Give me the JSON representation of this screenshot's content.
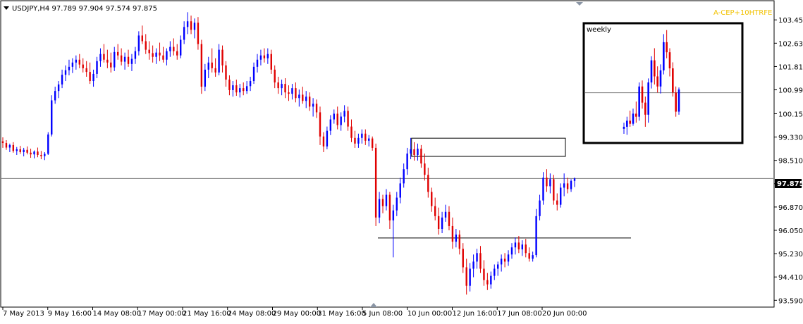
{
  "header": {
    "symbol_line": "USDJPY,H4  97.789 97.904 97.574 97.875",
    "ea_label": "A-CEP+10HTRFE",
    "menu_icon": "triangle-down-icon",
    "scroll_marker_icon": "triangle-down-icon",
    "bottom_marker_icon": "triangle-up-icon"
  },
  "colors": {
    "bull": "#0000ff",
    "bear": "#e00000",
    "current_price_bg": "#000000",
    "ea_label": "#f2c200",
    "axis": "#000000",
    "grid_line": "#808080"
  },
  "current_price": {
    "value": 97.875,
    "label": "97.875"
  },
  "inset": {
    "title": "weekly"
  },
  "chart_data": {
    "type": "candlestick",
    "y_ticks": [
      "103.450",
      "102.630",
      "101.810",
      "100.990",
      "100.150",
      "99.330",
      "98.510",
      "97.690",
      "96.870",
      "96.050",
      "95.230",
      "94.410",
      "93.590"
    ],
    "y_tick_values": [
      103.45,
      102.63,
      101.81,
      100.99,
      100.15,
      99.33,
      98.51,
      97.69,
      96.87,
      96.05,
      95.23,
      94.41,
      93.59
    ],
    "ylim": [
      93.4,
      104.05
    ],
    "x_ticks": [
      "7 May 2013",
      "9 May 16:00",
      "14 May 08:00",
      "17 May 00:00",
      "21 May 16:00",
      "24 May 08:00",
      "29 May 00:00",
      "31 May 16:00",
      "5 Jun 08:00",
      "10 Jun 00:00",
      "12 Jun 16:00",
      "17 Jun 08:00",
      "20 Jun 00:00"
    ],
    "annotations": [
      {
        "type": "rectangle",
        "price_top": 99.29,
        "price_bottom": 98.65,
        "from_x_label": "10 Jun 00:00",
        "to_x_label": "20 Jun 00:00"
      },
      {
        "type": "horizontal-segment",
        "price": 95.78,
        "from_x_label": "5 Jun 08:00",
        "to_x_label": "20 Jun 00:00"
      }
    ],
    "key_prices": {
      "first_close": 99.12,
      "high": 103.72,
      "high_date": "22 May 2013",
      "low": 93.79,
      "low_date": "13 Jun 2013",
      "last_close": 97.875
    },
    "ohlc": [
      {
        "o": 99.18,
        "h": 99.32,
        "l": 98.95,
        "c": 99.12
      },
      {
        "o": 99.12,
        "h": 99.22,
        "l": 98.88,
        "c": 98.96
      },
      {
        "o": 98.96,
        "h": 99.1,
        "l": 98.8,
        "c": 99.05
      },
      {
        "o": 99.05,
        "h": 99.15,
        "l": 98.78,
        "c": 98.84
      },
      {
        "o": 98.84,
        "h": 98.98,
        "l": 98.7,
        "c": 98.9
      },
      {
        "o": 98.9,
        "h": 99.02,
        "l": 98.74,
        "c": 98.8
      },
      {
        "o": 98.8,
        "h": 98.95,
        "l": 98.65,
        "c": 98.88
      },
      {
        "o": 98.88,
        "h": 99.0,
        "l": 98.72,
        "c": 98.78
      },
      {
        "o": 98.78,
        "h": 98.92,
        "l": 98.6,
        "c": 98.72
      },
      {
        "o": 98.72,
        "h": 98.86,
        "l": 98.58,
        "c": 98.82
      },
      {
        "o": 98.82,
        "h": 98.96,
        "l": 98.62,
        "c": 98.7
      },
      {
        "o": 98.7,
        "h": 98.84,
        "l": 98.55,
        "c": 98.66
      },
      {
        "o": 98.66,
        "h": 98.8,
        "l": 98.52,
        "c": 98.74
      },
      {
        "o": 98.74,
        "h": 99.5,
        "l": 98.7,
        "c": 99.42
      },
      {
        "o": 99.42,
        "h": 100.8,
        "l": 99.35,
        "c": 100.62
      },
      {
        "o": 100.62,
        "h": 101.1,
        "l": 100.5,
        "c": 100.95
      },
      {
        "o": 100.95,
        "h": 101.3,
        "l": 100.7,
        "c": 101.18
      },
      {
        "o": 101.18,
        "h": 101.7,
        "l": 101.05,
        "c": 101.52
      },
      {
        "o": 101.52,
        "h": 101.85,
        "l": 101.3,
        "c": 101.68
      },
      {
        "o": 101.68,
        "h": 102.05,
        "l": 101.5,
        "c": 101.8
      },
      {
        "o": 101.8,
        "h": 102.1,
        "l": 101.58,
        "c": 101.95
      },
      {
        "o": 101.95,
        "h": 102.2,
        "l": 101.7,
        "c": 102.05
      },
      {
        "o": 102.05,
        "h": 102.25,
        "l": 101.75,
        "c": 101.88
      },
      {
        "o": 101.88,
        "h": 102.1,
        "l": 101.6,
        "c": 101.75
      },
      {
        "o": 101.75,
        "h": 102.0,
        "l": 101.45,
        "c": 101.62
      },
      {
        "o": 101.62,
        "h": 101.95,
        "l": 101.2,
        "c": 101.3
      },
      {
        "o": 101.3,
        "h": 101.7,
        "l": 101.1,
        "c": 101.55
      },
      {
        "o": 101.55,
        "h": 102.15,
        "l": 101.4,
        "c": 102.0
      },
      {
        "o": 102.0,
        "h": 102.45,
        "l": 101.8,
        "c": 102.25
      },
      {
        "o": 102.25,
        "h": 102.6,
        "l": 101.95,
        "c": 102.05
      },
      {
        "o": 102.05,
        "h": 102.4,
        "l": 101.75,
        "c": 101.95
      },
      {
        "o": 101.95,
        "h": 102.3,
        "l": 101.6,
        "c": 101.78
      },
      {
        "o": 101.78,
        "h": 102.5,
        "l": 101.65,
        "c": 102.32
      },
      {
        "o": 102.32,
        "h": 102.6,
        "l": 102.05,
        "c": 102.2
      },
      {
        "o": 102.2,
        "h": 102.45,
        "l": 101.85,
        "c": 101.98
      },
      {
        "o": 101.98,
        "h": 102.3,
        "l": 101.7,
        "c": 102.15
      },
      {
        "o": 102.15,
        "h": 102.4,
        "l": 101.8,
        "c": 101.9
      },
      {
        "o": 101.9,
        "h": 102.25,
        "l": 101.65,
        "c": 102.08
      },
      {
        "o": 102.08,
        "h": 102.5,
        "l": 101.9,
        "c": 102.35
      },
      {
        "o": 102.35,
        "h": 103.05,
        "l": 102.2,
        "c": 102.9
      },
      {
        "o": 102.9,
        "h": 103.25,
        "l": 102.6,
        "c": 102.7
      },
      {
        "o": 102.7,
        "h": 102.95,
        "l": 102.25,
        "c": 102.4
      },
      {
        "o": 102.4,
        "h": 102.7,
        "l": 102.05,
        "c": 102.28
      },
      {
        "o": 102.28,
        "h": 102.55,
        "l": 101.95,
        "c": 102.15
      },
      {
        "o": 102.15,
        "h": 102.45,
        "l": 101.9,
        "c": 102.3
      },
      {
        "o": 102.3,
        "h": 102.65,
        "l": 102.0,
        "c": 102.2
      },
      {
        "o": 102.2,
        "h": 102.5,
        "l": 101.95,
        "c": 102.05
      },
      {
        "o": 102.05,
        "h": 102.45,
        "l": 101.85,
        "c": 102.35
      },
      {
        "o": 102.35,
        "h": 102.7,
        "l": 102.15,
        "c": 102.5
      },
      {
        "o": 102.5,
        "h": 102.8,
        "l": 102.2,
        "c": 102.35
      },
      {
        "o": 102.35,
        "h": 102.6,
        "l": 102.05,
        "c": 102.2
      },
      {
        "o": 102.2,
        "h": 102.9,
        "l": 102.1,
        "c": 102.75
      },
      {
        "o": 102.75,
        "h": 103.4,
        "l": 102.6,
        "c": 103.2
      },
      {
        "o": 103.2,
        "h": 103.72,
        "l": 102.95,
        "c": 103.4
      },
      {
        "o": 103.4,
        "h": 103.6,
        "l": 102.95,
        "c": 103.1
      },
      {
        "o": 103.1,
        "h": 103.5,
        "l": 102.8,
        "c": 103.35
      },
      {
        "o": 103.35,
        "h": 103.55,
        "l": 102.4,
        "c": 102.6
      },
      {
        "o": 102.6,
        "h": 102.75,
        "l": 100.85,
        "c": 101.1
      },
      {
        "o": 101.1,
        "h": 101.9,
        "l": 100.95,
        "c": 101.7
      },
      {
        "o": 101.7,
        "h": 102.15,
        "l": 101.4,
        "c": 101.95
      },
      {
        "o": 101.95,
        "h": 102.45,
        "l": 101.6,
        "c": 101.75
      },
      {
        "o": 101.75,
        "h": 102.1,
        "l": 101.45,
        "c": 101.6
      },
      {
        "o": 101.6,
        "h": 102.6,
        "l": 101.5,
        "c": 102.4
      },
      {
        "o": 102.4,
        "h": 102.55,
        "l": 101.6,
        "c": 101.85
      },
      {
        "o": 101.85,
        "h": 102.0,
        "l": 101.1,
        "c": 101.35
      },
      {
        "o": 101.35,
        "h": 101.5,
        "l": 100.8,
        "c": 100.98
      },
      {
        "o": 100.98,
        "h": 101.3,
        "l": 100.75,
        "c": 101.15
      },
      {
        "o": 101.15,
        "h": 101.35,
        "l": 100.78,
        "c": 100.9
      },
      {
        "o": 100.9,
        "h": 101.2,
        "l": 100.72,
        "c": 101.05
      },
      {
        "o": 101.05,
        "h": 101.25,
        "l": 100.8,
        "c": 100.95
      },
      {
        "o": 100.95,
        "h": 101.3,
        "l": 100.85,
        "c": 101.12
      },
      {
        "o": 101.12,
        "h": 101.45,
        "l": 100.95,
        "c": 101.3
      },
      {
        "o": 101.3,
        "h": 101.95,
        "l": 101.2,
        "c": 101.8
      },
      {
        "o": 101.8,
        "h": 102.25,
        "l": 101.6,
        "c": 102.05
      },
      {
        "o": 102.05,
        "h": 102.4,
        "l": 101.85,
        "c": 102.2
      },
      {
        "o": 102.2,
        "h": 102.45,
        "l": 101.95,
        "c": 102.1
      },
      {
        "o": 102.1,
        "h": 102.45,
        "l": 101.9,
        "c": 102.25
      },
      {
        "o": 102.25,
        "h": 102.4,
        "l": 101.55,
        "c": 101.7
      },
      {
        "o": 101.7,
        "h": 101.85,
        "l": 101.05,
        "c": 101.25
      },
      {
        "o": 101.25,
        "h": 101.45,
        "l": 100.85,
        "c": 101.05
      },
      {
        "o": 101.05,
        "h": 101.35,
        "l": 100.8,
        "c": 101.2
      },
      {
        "o": 101.2,
        "h": 101.4,
        "l": 100.7,
        "c": 100.9
      },
      {
        "o": 100.9,
        "h": 101.15,
        "l": 100.6,
        "c": 100.85
      },
      {
        "o": 100.85,
        "h": 101.2,
        "l": 100.65,
        "c": 101.05
      },
      {
        "o": 101.05,
        "h": 101.25,
        "l": 100.55,
        "c": 100.7
      },
      {
        "o": 100.7,
        "h": 101.0,
        "l": 100.4,
        "c": 100.82
      },
      {
        "o": 100.82,
        "h": 101.1,
        "l": 100.5,
        "c": 100.6
      },
      {
        "o": 100.6,
        "h": 100.95,
        "l": 100.35,
        "c": 100.75
      },
      {
        "o": 100.75,
        "h": 100.9,
        "l": 100.25,
        "c": 100.4
      },
      {
        "o": 100.4,
        "h": 100.7,
        "l": 100.05,
        "c": 100.5
      },
      {
        "o": 100.5,
        "h": 100.65,
        "l": 100.0,
        "c": 100.2
      },
      {
        "o": 100.2,
        "h": 100.4,
        "l": 99.05,
        "c": 99.35
      },
      {
        "o": 99.35,
        "h": 99.5,
        "l": 98.8,
        "c": 99.0
      },
      {
        "o": 99.0,
        "h": 99.7,
        "l": 98.9,
        "c": 99.55
      },
      {
        "o": 99.55,
        "h": 100.1,
        "l": 99.4,
        "c": 99.95
      },
      {
        "o": 99.95,
        "h": 100.3,
        "l": 99.8,
        "c": 100.15
      },
      {
        "o": 100.15,
        "h": 100.4,
        "l": 99.6,
        "c": 99.75
      },
      {
        "o": 99.75,
        "h": 100.2,
        "l": 99.55,
        "c": 100.05
      },
      {
        "o": 100.05,
        "h": 100.45,
        "l": 99.85,
        "c": 100.25
      },
      {
        "o": 100.25,
        "h": 100.4,
        "l": 99.55,
        "c": 99.7
      },
      {
        "o": 99.7,
        "h": 99.95,
        "l": 99.15,
        "c": 99.3
      },
      {
        "o": 99.3,
        "h": 99.55,
        "l": 98.95,
        "c": 99.1
      },
      {
        "o": 99.1,
        "h": 99.45,
        "l": 98.95,
        "c": 99.3
      },
      {
        "o": 99.3,
        "h": 99.6,
        "l": 99.1,
        "c": 99.45
      },
      {
        "o": 99.45,
        "h": 99.6,
        "l": 99.05,
        "c": 99.2
      },
      {
        "o": 99.2,
        "h": 99.4,
        "l": 99.0,
        "c": 99.28
      },
      {
        "o": 99.28,
        "h": 99.35,
        "l": 98.85,
        "c": 98.95
      },
      {
        "o": 98.95,
        "h": 99.1,
        "l": 96.2,
        "c": 96.5
      },
      {
        "o": 96.5,
        "h": 97.4,
        "l": 96.3,
        "c": 97.15
      },
      {
        "o": 97.15,
        "h": 97.3,
        "l": 96.65,
        "c": 96.9
      },
      {
        "o": 96.9,
        "h": 97.5,
        "l": 96.75,
        "c": 97.3
      },
      {
        "o": 97.3,
        "h": 97.4,
        "l": 96.1,
        "c": 96.4
      },
      {
        "o": 96.4,
        "h": 96.95,
        "l": 95.1,
        "c": 96.75
      },
      {
        "o": 96.75,
        "h": 97.4,
        "l": 96.55,
        "c": 97.2
      },
      {
        "o": 97.2,
        "h": 97.9,
        "l": 97.0,
        "c": 97.7
      },
      {
        "o": 97.7,
        "h": 98.4,
        "l": 97.55,
        "c": 98.2
      },
      {
        "o": 98.2,
        "h": 98.95,
        "l": 98.0,
        "c": 98.75
      },
      {
        "o": 98.75,
        "h": 99.3,
        "l": 98.55,
        "c": 98.9
      },
      {
        "o": 98.9,
        "h": 99.15,
        "l": 98.5,
        "c": 98.7
      },
      {
        "o": 98.7,
        "h": 99.1,
        "l": 98.5,
        "c": 98.92
      },
      {
        "o": 98.92,
        "h": 99.05,
        "l": 98.25,
        "c": 98.4
      },
      {
        "o": 98.4,
        "h": 98.75,
        "l": 97.8,
        "c": 98.0
      },
      {
        "o": 98.0,
        "h": 98.25,
        "l": 97.2,
        "c": 97.4
      },
      {
        "o": 97.4,
        "h": 97.55,
        "l": 96.7,
        "c": 96.9
      },
      {
        "o": 96.9,
        "h": 97.2,
        "l": 96.4,
        "c": 96.55
      },
      {
        "o": 96.55,
        "h": 96.85,
        "l": 95.9,
        "c": 96.1
      },
      {
        "o": 96.1,
        "h": 96.7,
        "l": 95.95,
        "c": 96.5
      },
      {
        "o": 96.5,
        "h": 96.95,
        "l": 96.35,
        "c": 96.7
      },
      {
        "o": 96.7,
        "h": 96.9,
        "l": 96.05,
        "c": 96.2
      },
      {
        "o": 96.2,
        "h": 96.5,
        "l": 95.4,
        "c": 95.65
      },
      {
        "o": 95.65,
        "h": 96.1,
        "l": 95.45,
        "c": 95.9
      },
      {
        "o": 95.9,
        "h": 96.05,
        "l": 95.2,
        "c": 95.4
      },
      {
        "o": 95.4,
        "h": 95.6,
        "l": 94.55,
        "c": 94.75
      },
      {
        "o": 94.75,
        "h": 95.05,
        "l": 93.79,
        "c": 94.1
      },
      {
        "o": 94.1,
        "h": 94.9,
        "l": 93.9,
        "c": 94.7
      },
      {
        "o": 94.7,
        "h": 95.2,
        "l": 94.4,
        "c": 94.95
      },
      {
        "o": 94.95,
        "h": 95.4,
        "l": 94.7,
        "c": 95.25
      },
      {
        "o": 95.25,
        "h": 95.5,
        "l": 94.55,
        "c": 94.7
      },
      {
        "o": 94.7,
        "h": 95.0,
        "l": 94.1,
        "c": 94.3
      },
      {
        "o": 94.3,
        "h": 94.55,
        "l": 93.95,
        "c": 94.15
      },
      {
        "o": 94.15,
        "h": 94.6,
        "l": 94.0,
        "c": 94.45
      },
      {
        "o": 94.45,
        "h": 94.85,
        "l": 94.3,
        "c": 94.7
      },
      {
        "o": 94.7,
        "h": 94.95,
        "l": 94.45,
        "c": 94.85
      },
      {
        "o": 94.85,
        "h": 95.2,
        "l": 94.6,
        "c": 95.05
      },
      {
        "o": 95.05,
        "h": 95.25,
        "l": 94.75,
        "c": 94.95
      },
      {
        "o": 94.95,
        "h": 95.35,
        "l": 94.8,
        "c": 95.2
      },
      {
        "o": 95.2,
        "h": 95.6,
        "l": 95.05,
        "c": 95.45
      },
      {
        "o": 95.45,
        "h": 95.8,
        "l": 95.2,
        "c": 95.62
      },
      {
        "o": 95.62,
        "h": 95.85,
        "l": 95.25,
        "c": 95.38
      },
      {
        "o": 95.38,
        "h": 95.7,
        "l": 95.15,
        "c": 95.55
      },
      {
        "o": 95.55,
        "h": 95.75,
        "l": 95.1,
        "c": 95.25
      },
      {
        "o": 95.25,
        "h": 95.45,
        "l": 94.95,
        "c": 95.05
      },
      {
        "o": 95.05,
        "h": 95.3,
        "l": 94.95,
        "c": 95.18
      },
      {
        "o": 95.18,
        "h": 96.8,
        "l": 95.1,
        "c": 96.55
      },
      {
        "o": 96.55,
        "h": 97.3,
        "l": 96.4,
        "c": 97.1
      },
      {
        "o": 97.1,
        "h": 98.1,
        "l": 96.95,
        "c": 97.9
      },
      {
        "o": 97.9,
        "h": 98.2,
        "l": 97.4,
        "c": 97.6
      },
      {
        "o": 97.6,
        "h": 98.05,
        "l": 97.35,
        "c": 97.85
      },
      {
        "o": 97.85,
        "h": 98.0,
        "l": 96.95,
        "c": 97.1
      },
      {
        "o": 97.1,
        "h": 97.35,
        "l": 96.75,
        "c": 96.95
      },
      {
        "o": 96.95,
        "h": 97.7,
        "l": 96.85,
        "c": 97.55
      },
      {
        "o": 97.55,
        "h": 98.05,
        "l": 97.25,
        "c": 97.7
      },
      {
        "o": 97.7,
        "h": 97.9,
        "l": 97.35,
        "c": 97.5
      },
      {
        "o": 97.5,
        "h": 97.85,
        "l": 97.4,
        "c": 97.79
      },
      {
        "o": 97.789,
        "h": 97.904,
        "l": 97.574,
        "c": 97.875
      }
    ],
    "weekly": {
      "ohlc": [
        {
          "o": 99.2,
          "h": 99.5,
          "l": 98.95,
          "c": 99.3
        },
        {
          "o": 99.3,
          "h": 99.8,
          "l": 98.9,
          "c": 99.6
        },
        {
          "o": 99.6,
          "h": 100.1,
          "l": 99.3,
          "c": 99.45
        },
        {
          "o": 99.45,
          "h": 100.2,
          "l": 99.35,
          "c": 99.95
        },
        {
          "o": 99.95,
          "h": 100.55,
          "l": 99.5,
          "c": 99.8
        },
        {
          "o": 99.8,
          "h": 101.5,
          "l": 99.6,
          "c": 101.3
        },
        {
          "o": 101.3,
          "h": 101.6,
          "l": 100.2,
          "c": 100.5
        },
        {
          "o": 100.5,
          "h": 100.8,
          "l": 99.3,
          "c": 99.9
        },
        {
          "o": 99.9,
          "h": 101.7,
          "l": 99.5,
          "c": 101.5
        },
        {
          "o": 101.5,
          "h": 102.8,
          "l": 101.2,
          "c": 102.6
        },
        {
          "o": 102.6,
          "h": 103.2,
          "l": 101.4,
          "c": 101.8
        },
        {
          "o": 101.8,
          "h": 102.3,
          "l": 101.0,
          "c": 101.3
        },
        {
          "o": 101.3,
          "h": 102.4,
          "l": 100.95,
          "c": 102.1
        },
        {
          "o": 102.1,
          "h": 103.9,
          "l": 101.9,
          "c": 103.5
        },
        {
          "o": 103.5,
          "h": 104.1,
          "l": 102.7,
          "c": 103.0
        },
        {
          "o": 103.0,
          "h": 103.2,
          "l": 101.8,
          "c": 102.2
        },
        {
          "o": 102.2,
          "h": 102.5,
          "l": 100.8,
          "c": 101.0
        },
        {
          "o": 101.0,
          "h": 101.3,
          "l": 99.8,
          "c": 100.05
        },
        {
          "o": 100.05,
          "h": 101.25,
          "l": 99.9,
          "c": 101.15
        }
      ],
      "ylim": [
        98.6,
        104.3
      ],
      "current_price": 100.99
    }
  }
}
